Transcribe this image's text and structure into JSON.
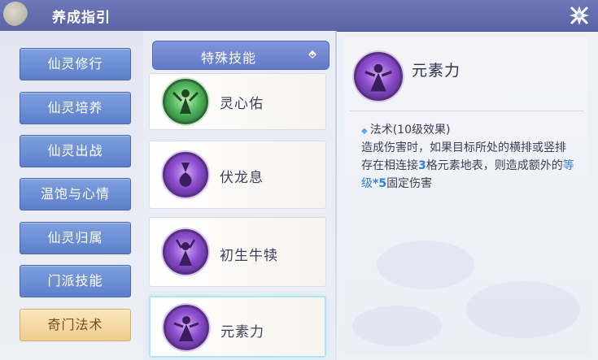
{
  "window": {
    "title": "养成指引"
  },
  "nav": {
    "items": [
      {
        "label": "仙灵修行",
        "active": false
      },
      {
        "label": "仙灵培养",
        "active": false
      },
      {
        "label": "仙灵出战",
        "active": false
      },
      {
        "label": "温饱与心情",
        "active": false
      },
      {
        "label": "仙灵归属",
        "active": false
      },
      {
        "label": "门派技能",
        "active": false
      },
      {
        "label": "奇门法术",
        "active": true
      }
    ]
  },
  "category_dropdown": {
    "selected": "特殊技能"
  },
  "skills": [
    {
      "name": "灵心佑",
      "icon": "green-figure-icon",
      "selected": false
    },
    {
      "name": "伏龙息",
      "icon": "purple-spirit-icon",
      "selected": false
    },
    {
      "name": "初生牛犊",
      "icon": "purple-figure-icon",
      "selected": false
    },
    {
      "name": "元素力",
      "icon": "purple-dancer-icon",
      "selected": true
    }
  ],
  "detail": {
    "name": "元素力",
    "subtitle": "法术(10级效果)",
    "desc_1": "造成伤害时，如果目标所处的横排或竖排存在相连接",
    "desc_num": "3",
    "desc_2": "格元素地表，则造成额外的",
    "desc_level": "等级",
    "desc_mult": "*5",
    "desc_3": "固定伤害"
  },
  "colors": {
    "title_bar": "#5a64a6",
    "nav_button": "#6b8cd4",
    "nav_active": "#f3d59c",
    "highlight": "#2f7fe0"
  }
}
